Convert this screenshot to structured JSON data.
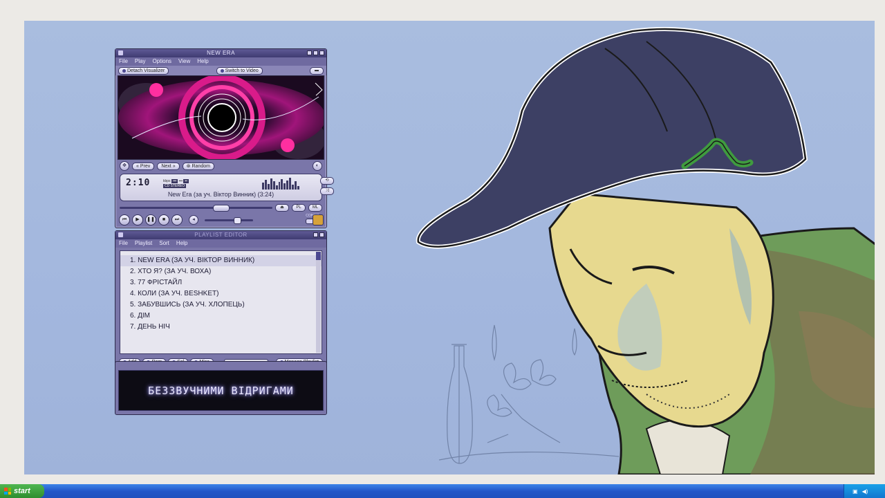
{
  "player": {
    "title": "NEW ERA",
    "menu": [
      "File",
      "Play",
      "Options",
      "View",
      "Help"
    ],
    "detach_label": "Detach Visualizer",
    "switch_label": "Switch to Video",
    "prev_label": "Prev",
    "next_label": "Next",
    "random_label": "Random",
    "time": "2:10",
    "meta_kbps": "kbps",
    "meta_stereo": "CD STEREO",
    "now_playing": "New Era (за уч. Віктор Винник) (3:24)",
    "pl_label": "PL",
    "ml_label": "ML",
    "config_label": "CONFIG"
  },
  "playlist": {
    "title": "PLAYLIST EDITOR",
    "menu": [
      "File",
      "Playlist",
      "Sort",
      "Help"
    ],
    "items": [
      "1. NEW ERA (ЗА УЧ. ВІКТОР ВИННИК)",
      "2. ХТО Я? (ЗА УЧ. ВОХА)",
      "3. 77 ФРІСТАЙЛ",
      "4. КОЛИ (ЗА УЧ. BESHKET)",
      "5. ЗАБУВШИСЬ (ЗА УЧ. ХЛОПЕЦЬ)",
      "6. ДІМ",
      "7. ДЕНЬ НІЧ"
    ],
    "add_label": "Add",
    "rem_label": "Rem",
    "sel_label": "Sel",
    "misc_label": "Misc",
    "total_time": "3:24/22:44",
    "manage_label": "Manage Playlist"
  },
  "lyrics": {
    "text": "БЕЗЗВУЧНИМИ ВІДРИГАМИ"
  },
  "taskbar": {
    "start_label": "start"
  },
  "colors": {
    "desktop": "#a9bddf",
    "skin": "#7a76a9",
    "accent": "#4c4890",
    "start_green": "#3aa23a",
    "taskbar_blue": "#2257c9"
  },
  "icons": {
    "skin_logo": "player-logo-icon",
    "windows_flag": "windows-logo-icon",
    "tray_network": "network-icon",
    "tray_volume": "speaker-icon"
  }
}
